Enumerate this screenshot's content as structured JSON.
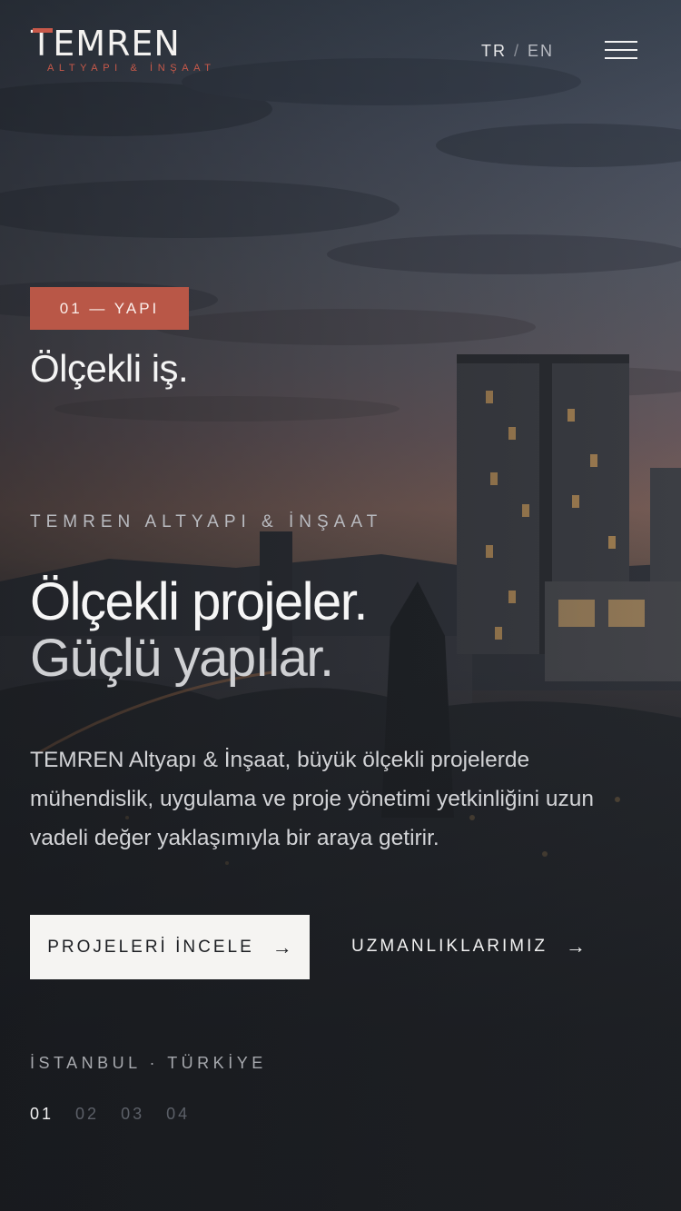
{
  "header": {
    "logo_text": "TEMREN",
    "logo_sub": "ALTYAPI & İNŞAAT",
    "lang_active": "TR",
    "lang_sep": "/",
    "lang_other": "EN",
    "menu_icon": "hamburger-menu-icon"
  },
  "hero": {
    "badge": "01 — YAPI",
    "slide_title": "Ölçekli iş.",
    "eyebrow": "TEMREN ALTYAPI & İNŞAAT",
    "headline_line1": "Ölçekli projeler.",
    "headline_line2": "Güçlü yapılar.",
    "description": "TEMREN Altyapı & İnşaat, büyük ölçekli projelerde mühendislik, uygulama ve proje yönetimi yetkinliğini uzun vadeli değer yaklaşımıyla bir araya getirir.",
    "primary_cta": "PROJELERİ İNCELE",
    "secondary_cta": "UZMANLIKLARIMIZ",
    "arrow": "→",
    "location": "İSTANBUL · TÜRKİYE"
  },
  "pager": {
    "items": [
      "01",
      "02",
      "03",
      "04"
    ],
    "active_index": 0
  },
  "colors": {
    "accent": "#b95747",
    "logo_accent": "#c8594a",
    "button_bg": "#f5f4f2",
    "text_primary": "#f6f6f6",
    "text_muted": "#b9bbc0"
  }
}
